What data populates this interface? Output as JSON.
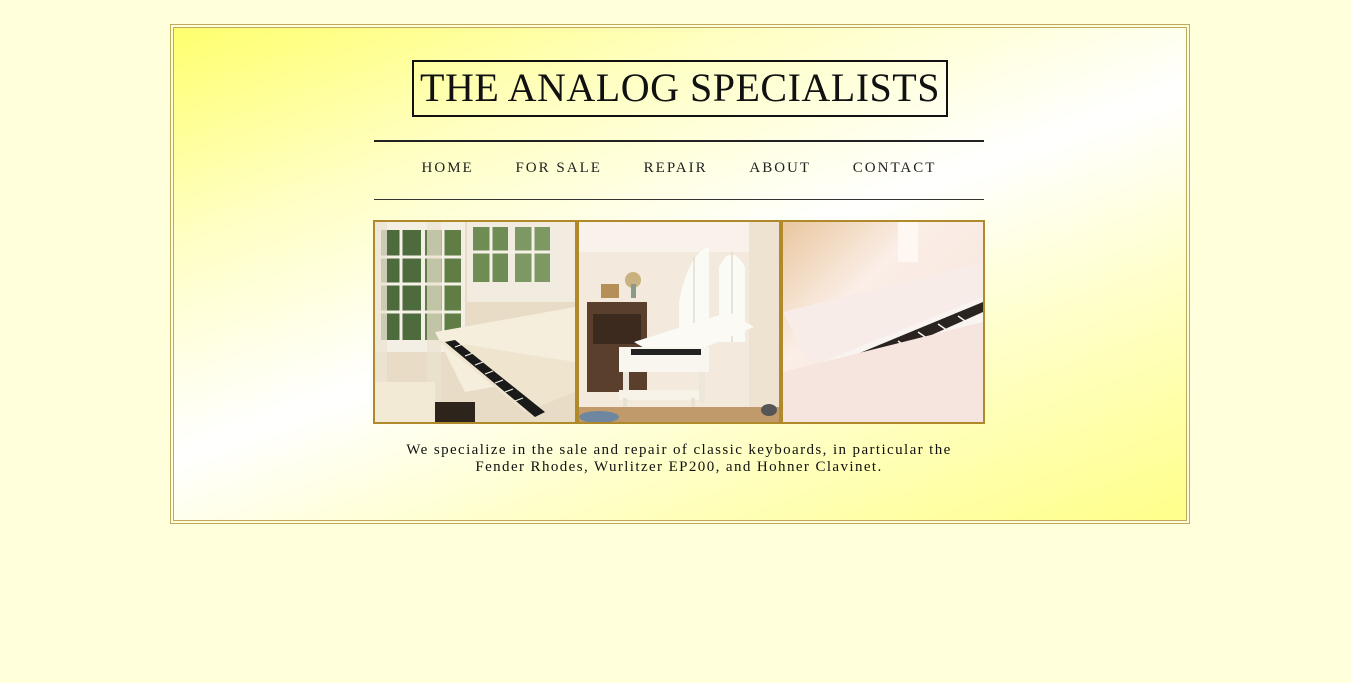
{
  "site": {
    "title": "THE ANALOG SPECIALISTS"
  },
  "nav": {
    "items": [
      {
        "label": "HOME"
      },
      {
        "label": "FOR SALE"
      },
      {
        "label": "REPAIR"
      },
      {
        "label": "ABOUT"
      },
      {
        "label": "CONTACT"
      }
    ]
  },
  "gallery": {
    "photos": [
      {
        "name": "grand-piano-window-photo"
      },
      {
        "name": "white-grand-piano-room-photo"
      },
      {
        "name": "piano-keys-closeup-photo"
      }
    ]
  },
  "intro": {
    "line1": "We specialize in the sale and repair of classic keyboards, in particular the",
    "line2": "Fender Rhodes, Wurlitzer EP200, and Hohner Clavinet."
  },
  "colors": {
    "background": "#ffffdc",
    "frame_border": "#bfa95a",
    "photo_border": "#b08a2a"
  }
}
